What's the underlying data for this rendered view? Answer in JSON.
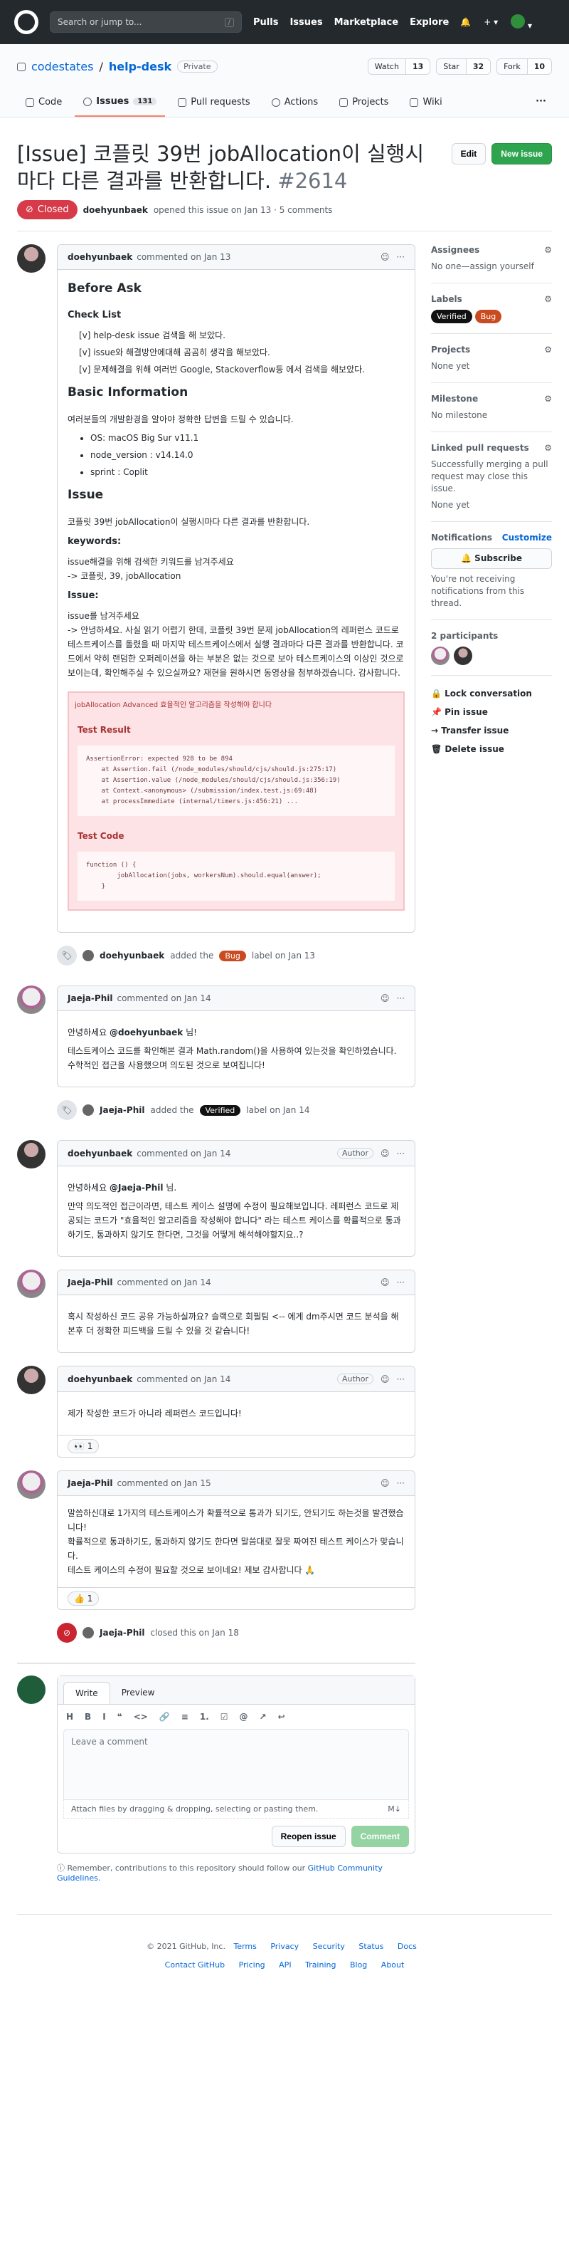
{
  "header": {
    "search_placeholder": "Search or jump to...",
    "search_key": "/",
    "nav": [
      "Pulls",
      "Issues",
      "Marketplace",
      "Explore"
    ]
  },
  "repo": {
    "owner": "codestates",
    "name": "help-desk",
    "visibility": "Private",
    "watch_label": "Watch",
    "watch_count": "13",
    "star_label": "Star",
    "star_count": "32",
    "fork_label": "Fork",
    "fork_count": "10"
  },
  "tabs": [
    {
      "label": "Code"
    },
    {
      "label": "Issues",
      "count": "131"
    },
    {
      "label": "Pull requests"
    },
    {
      "label": "Actions"
    },
    {
      "label": "Projects"
    },
    {
      "label": "Wiki"
    }
  ],
  "issue": {
    "title": "[Issue] 코플릿 39번 jobAllocation이 실행시마다 다른 결과를 반환합니다.",
    "number": "#2614",
    "edit_label": "Edit",
    "new_issue_label": "New issue",
    "state": "Closed",
    "author": "doehyunbaek",
    "opened_text": "opened this issue on Jan 13 · 5 comments"
  },
  "first_comment": {
    "author": "doehyunbaek",
    "when": "commented on Jan 13",
    "before_ask": "Before Ask",
    "checklist_title": "Check List",
    "checklist": [
      "[v] help-desk issue 검색을 해 보았다.",
      "[v] issue와 해결방안에대해 곰곰히 생각을 해보았다.",
      "[v] 문제해결을 위해 여러번 Google, Stackoverflow등 에서 검색을 해보았다."
    ],
    "basic_info_title": "Basic Information",
    "basic_info_desc": "여러분들의 개발환경을 알아야 정확한 답변을 드릴 수 있습니다.",
    "basic_info": [
      "OS: macOS Big Sur v11.1",
      "node_version : v14.14.0",
      "sprint : Coplit"
    ],
    "issue_title": "Issue",
    "issue_desc": "코플릿 39번 jobAllocation이 실행시마다 다른 결과를 반환합니다.",
    "keywords_title": "keywords:",
    "keywords_line1": "issue해결을 위해 검색한 키워드를 남겨주세요",
    "keywords_line2": "-> 코플릿, 39, jobAllocation",
    "issue_label": "Issue:",
    "issue_body_1": "issue를 남겨주세요",
    "issue_body_2": "-> 안녕하세요. 사실 읽기 어렵기 한데, 코플릿 39번 문제 jobAllocation의 레퍼런스 코드로 테스트케이스를 돌렸을 때 마지막 테스트케이스에서 실행 결과마다 다른 결과를 반환합니다. 코드에서 약히 랜덤한 오퍼레이션을 하는 부분은 없는 것으로 보아 테스트케이스의 이상인 것으로 보이는데, 확인해주실 수 있으실까요? 재현을 원하시면 동영상을 첨부하겠습니다. 감사합니다.",
    "err_header": "jobAllocation Advanced 효율적인 알고리즘을 작성해야 합니다",
    "err_test_result": "Test Result",
    "err_trace": "AssertionError: expected 928 to be 894\n    at Assertion.fail (/node_modules/should/cjs/should.js:275:17)\n    at Assertion.value (/node_modules/should/cjs/should.js:356:19)\n    at Context.<anonymous> (/submission/index.test.js:69:48)\n    at processImmediate (internal/timers.js:456:21) ...",
    "err_test_code": "Test Code",
    "err_code": "function () {\n        jobAllocation(jobs, workersNum).should.equal(answer);\n    }"
  },
  "event1": {
    "actor": "doehyunbaek",
    "pre": "added the",
    "label": "Bug",
    "post": "label on Jan 13"
  },
  "comment2": {
    "author": "Jaeja-Phil",
    "when": "commented on Jan 14",
    "l1_pre": "안녕하세요 ",
    "l1_mention": "@doehyunbaek",
    "l1_post": " 님!",
    "l2": "테스트케이스 코드를 확인해본 결과 Math.random()을 사용하여 있는것을 확인하였습니다. 수학적인 접근을 사용했으며 의도된 것으로 보여집니다!"
  },
  "event2": {
    "actor": "Jaeja-Phil",
    "pre": "added the",
    "label": "Verified",
    "post": "label on Jan 14"
  },
  "comment3": {
    "author": "doehyunbaek",
    "when": "commented on Jan 14",
    "badge": "Author",
    "l1_pre": "안녕하세요 ",
    "l1_mention": "@Jaeja-Phil",
    "l1_post": " 님.",
    "l2": "만약 의도적인 접근이라면, 테스트 케이스 설명에 수정이 필요해보입니다. 레퍼런스 코드로 제공되는 코드가 \"효율적인 알고리즘을 작성해야 합니다\" 라는 테스트 케이스를 확률적으로 통과하기도, 통과하지 않기도 한다면, 그것을 어떻게 해석해야할지요..?"
  },
  "comment4": {
    "author": "Jaeja-Phil",
    "when": "commented on Jan 14",
    "body": "혹시 작성하신 코드 공유 가능하실까요? 슬랙으로 회필팀 <-- 에게 dm주시면 코드 분석을 해본후 더 정확한 피드백을 드릴 수 있을 것 같습니다!"
  },
  "comment5": {
    "author": "doehyunbaek",
    "when": "commented on Jan 14",
    "badge": "Author",
    "body": "제가 작성한 코드가 아니라 레퍼런스 코드입니다!",
    "reaction": "👀 1"
  },
  "comment6": {
    "author": "Jaeja-Phil",
    "when": "commented on Jan 15",
    "l1": "말씀하신대로 1가지의 테스트케이스가 확률적으로 통과가 되기도, 안되기도 하는것을 발견했습니다!",
    "l2": "확률적으로 통과하기도, 통과하지 않기도 한다면 말씀대로 잘못 짜여진 테스트 케이스가 맞습니다.",
    "l3": "테스트 케이스의 수정이 필요할 것으로 보이네요! 제보 감사합니다 🙏",
    "reaction": "👍 1"
  },
  "event3": {
    "actor": "Jaeja-Phil",
    "text": "closed this on Jan 18"
  },
  "composer": {
    "tab_write": "Write",
    "tab_preview": "Preview",
    "toolbar": [
      "H",
      "B",
      "I",
      "❝",
      "<>",
      "🔗",
      "≡",
      "1.",
      "☑",
      "@",
      "↗",
      "↩"
    ],
    "placeholder": "Leave a comment",
    "attach": "Attach files by dragging & dropping, selecting or pasting them.",
    "md": "M↓",
    "reopen": "Reopen issue",
    "comment": "Comment",
    "remember_pre": "Remember, contributions to this repository should follow our ",
    "remember_link": "GitHub Community Guidelines",
    "remember_post": "."
  },
  "sidebar": {
    "assignees_title": "Assignees",
    "assignees_value": "No one—assign yourself",
    "labels_title": "Labels",
    "label1": "Verified",
    "label2": "Bug",
    "projects_title": "Projects",
    "projects_value": "None yet",
    "milestone_title": "Milestone",
    "milestone_value": "No milestone",
    "linked_title": "Linked pull requests",
    "linked_desc": "Successfully merging a pull request may close this issue.",
    "linked_value": "None yet",
    "notif_title": "Notifications",
    "notif_customize": "Customize",
    "subscribe": "Subscribe",
    "notif_desc": "You're not receiving notifications from this thread.",
    "participants": "2 participants",
    "lock": "Lock conversation",
    "pin": "Pin issue",
    "transfer": "Transfer issue",
    "delete": "Delete issue"
  },
  "footer": {
    "copyright": "© 2021 GitHub, Inc.",
    "row1": [
      "Terms",
      "Privacy",
      "Security",
      "Status",
      "Docs"
    ],
    "row2": [
      "Contact GitHub",
      "Pricing",
      "API",
      "Training",
      "Blog",
      "About"
    ]
  }
}
